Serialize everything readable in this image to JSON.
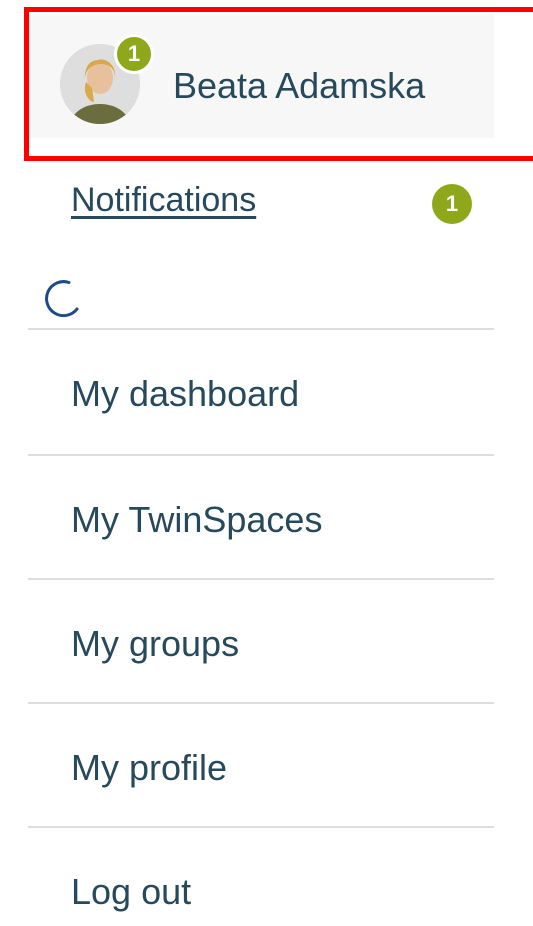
{
  "user": {
    "name": "Beata Adamska",
    "badge_count": "1",
    "avatar_icon": "user-avatar-photo"
  },
  "notifications": {
    "label": "Notifications",
    "count": "1"
  },
  "loading_icon": "spinner-icon",
  "menu": {
    "items": [
      {
        "label": "My dashboard"
      },
      {
        "label": "My TwinSpaces"
      },
      {
        "label": "My groups"
      },
      {
        "label": "My profile"
      },
      {
        "label": "Log out"
      }
    ]
  },
  "colors": {
    "text": "#26495c",
    "badge": "#8fa81b",
    "highlight": "#ff0000",
    "divider": "#dedede",
    "header_bg": "#f7f7f7"
  }
}
